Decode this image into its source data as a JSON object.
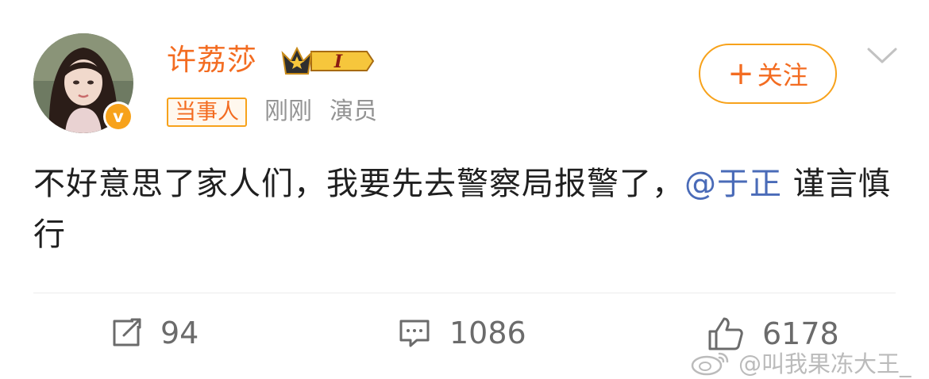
{
  "user": {
    "name": "许荔莎",
    "level_badge": "I",
    "role_tag": "当事人",
    "time": "刚刚",
    "title": "演员",
    "verified_mark": "v"
  },
  "follow_button": {
    "plus": "+",
    "label": "关注"
  },
  "post": {
    "text_before": "不好意思了家人们，我要先去警察局报警了，",
    "mention": "@于正",
    "text_after": " 谨言慎行"
  },
  "actions": {
    "repost_count": "94",
    "comment_count": "1086",
    "like_count": "6178"
  },
  "watermark": "@叫我果冻大王_",
  "colors": {
    "accent_orange": "#f36c21",
    "badge_gold": "#f7a21b",
    "mention_blue": "#4a6bb8"
  }
}
